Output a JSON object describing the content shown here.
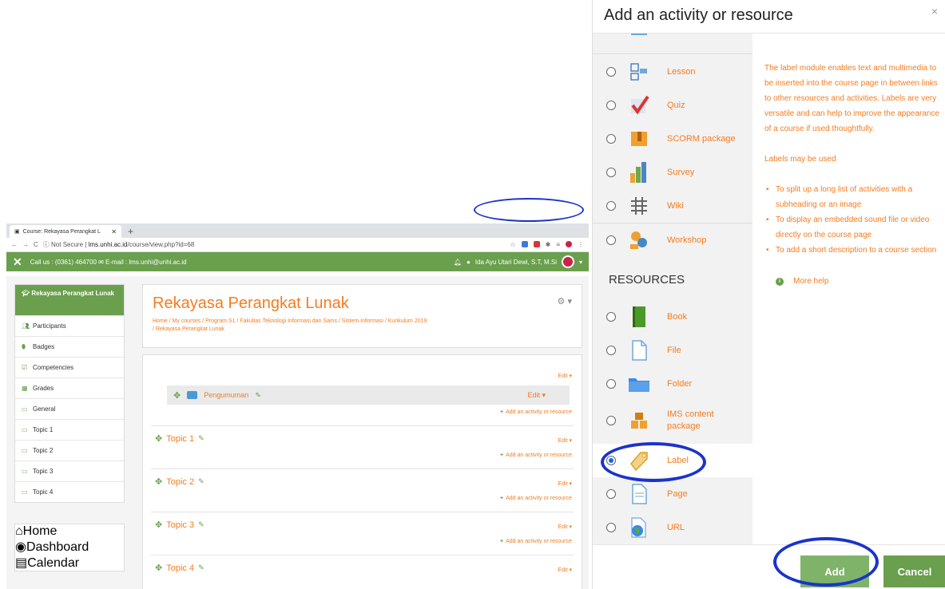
{
  "browser": {
    "tab_title": "Course: Rekayasa Perangkat L",
    "url_prefix": "Not Secure | ",
    "url_domain": "lms.unhi.ac.id",
    "url_path": "/course/view.php?id=68",
    "nav_contact": "Call us : (0361) 464700 ✉ E-mail : lms.unhi@unhi.ac.id",
    "user_name": "Ida Ayu Utari Dewi, S.T, M.Si"
  },
  "sidebar": {
    "active": "Rekayasa Perangkat Lunak",
    "items": [
      "Participants",
      "Badges",
      "Competencies",
      "Grades",
      "General",
      "Topic 1",
      "Topic 2",
      "Topic 3",
      "Topic 4"
    ],
    "items2": [
      "Home",
      "Dashboard",
      "Calendar"
    ]
  },
  "course": {
    "title": "Rekayasa Perangkat Lunak",
    "breadcrumb1": "Home / My courses / Program S1 / Fakultas Teknologi Informasi dan Sains / Sistem Informasi / Kurikulum 2019",
    "breadcrumb2": "/ Rekayasa Perangkat Lunak",
    "edit": "Edit ▾",
    "forum": "Pengumuman",
    "add_activity": "Add an activity or resource",
    "topics": [
      "Topic 1",
      "Topic 2",
      "Topic 3",
      "Topic 4"
    ]
  },
  "modal": {
    "title": "Add an activity or resource",
    "close": "×",
    "activities": [
      "Lesson",
      "Quiz",
      "SCORM package",
      "Survey",
      "Wiki",
      "Workshop"
    ],
    "resources_heading": "RESOURCES",
    "resources": [
      "Book",
      "File",
      "Folder",
      "IMS content package",
      "Label",
      "Page",
      "URL"
    ],
    "selected": "Label",
    "help_p1": "The label module enables text and multimedia to be inserted into the course page in between links to other resources and activities. Labels are very versatile and can help to improve the appearance of a course if used thoughtfully.",
    "help_p2": "Labels may be used",
    "help_bullets": [
      "To split up a long list of activities with a subheading or an image",
      "To display an embedded sound file or video directly on the course page",
      "To add a short description to a course section"
    ],
    "more_help": "More help",
    "add_button": "Add",
    "cancel_button": "Cancel"
  },
  "colors": {
    "accent": "#f47c20",
    "green": "#6a9f4d",
    "highlight": "#1a33cc"
  }
}
